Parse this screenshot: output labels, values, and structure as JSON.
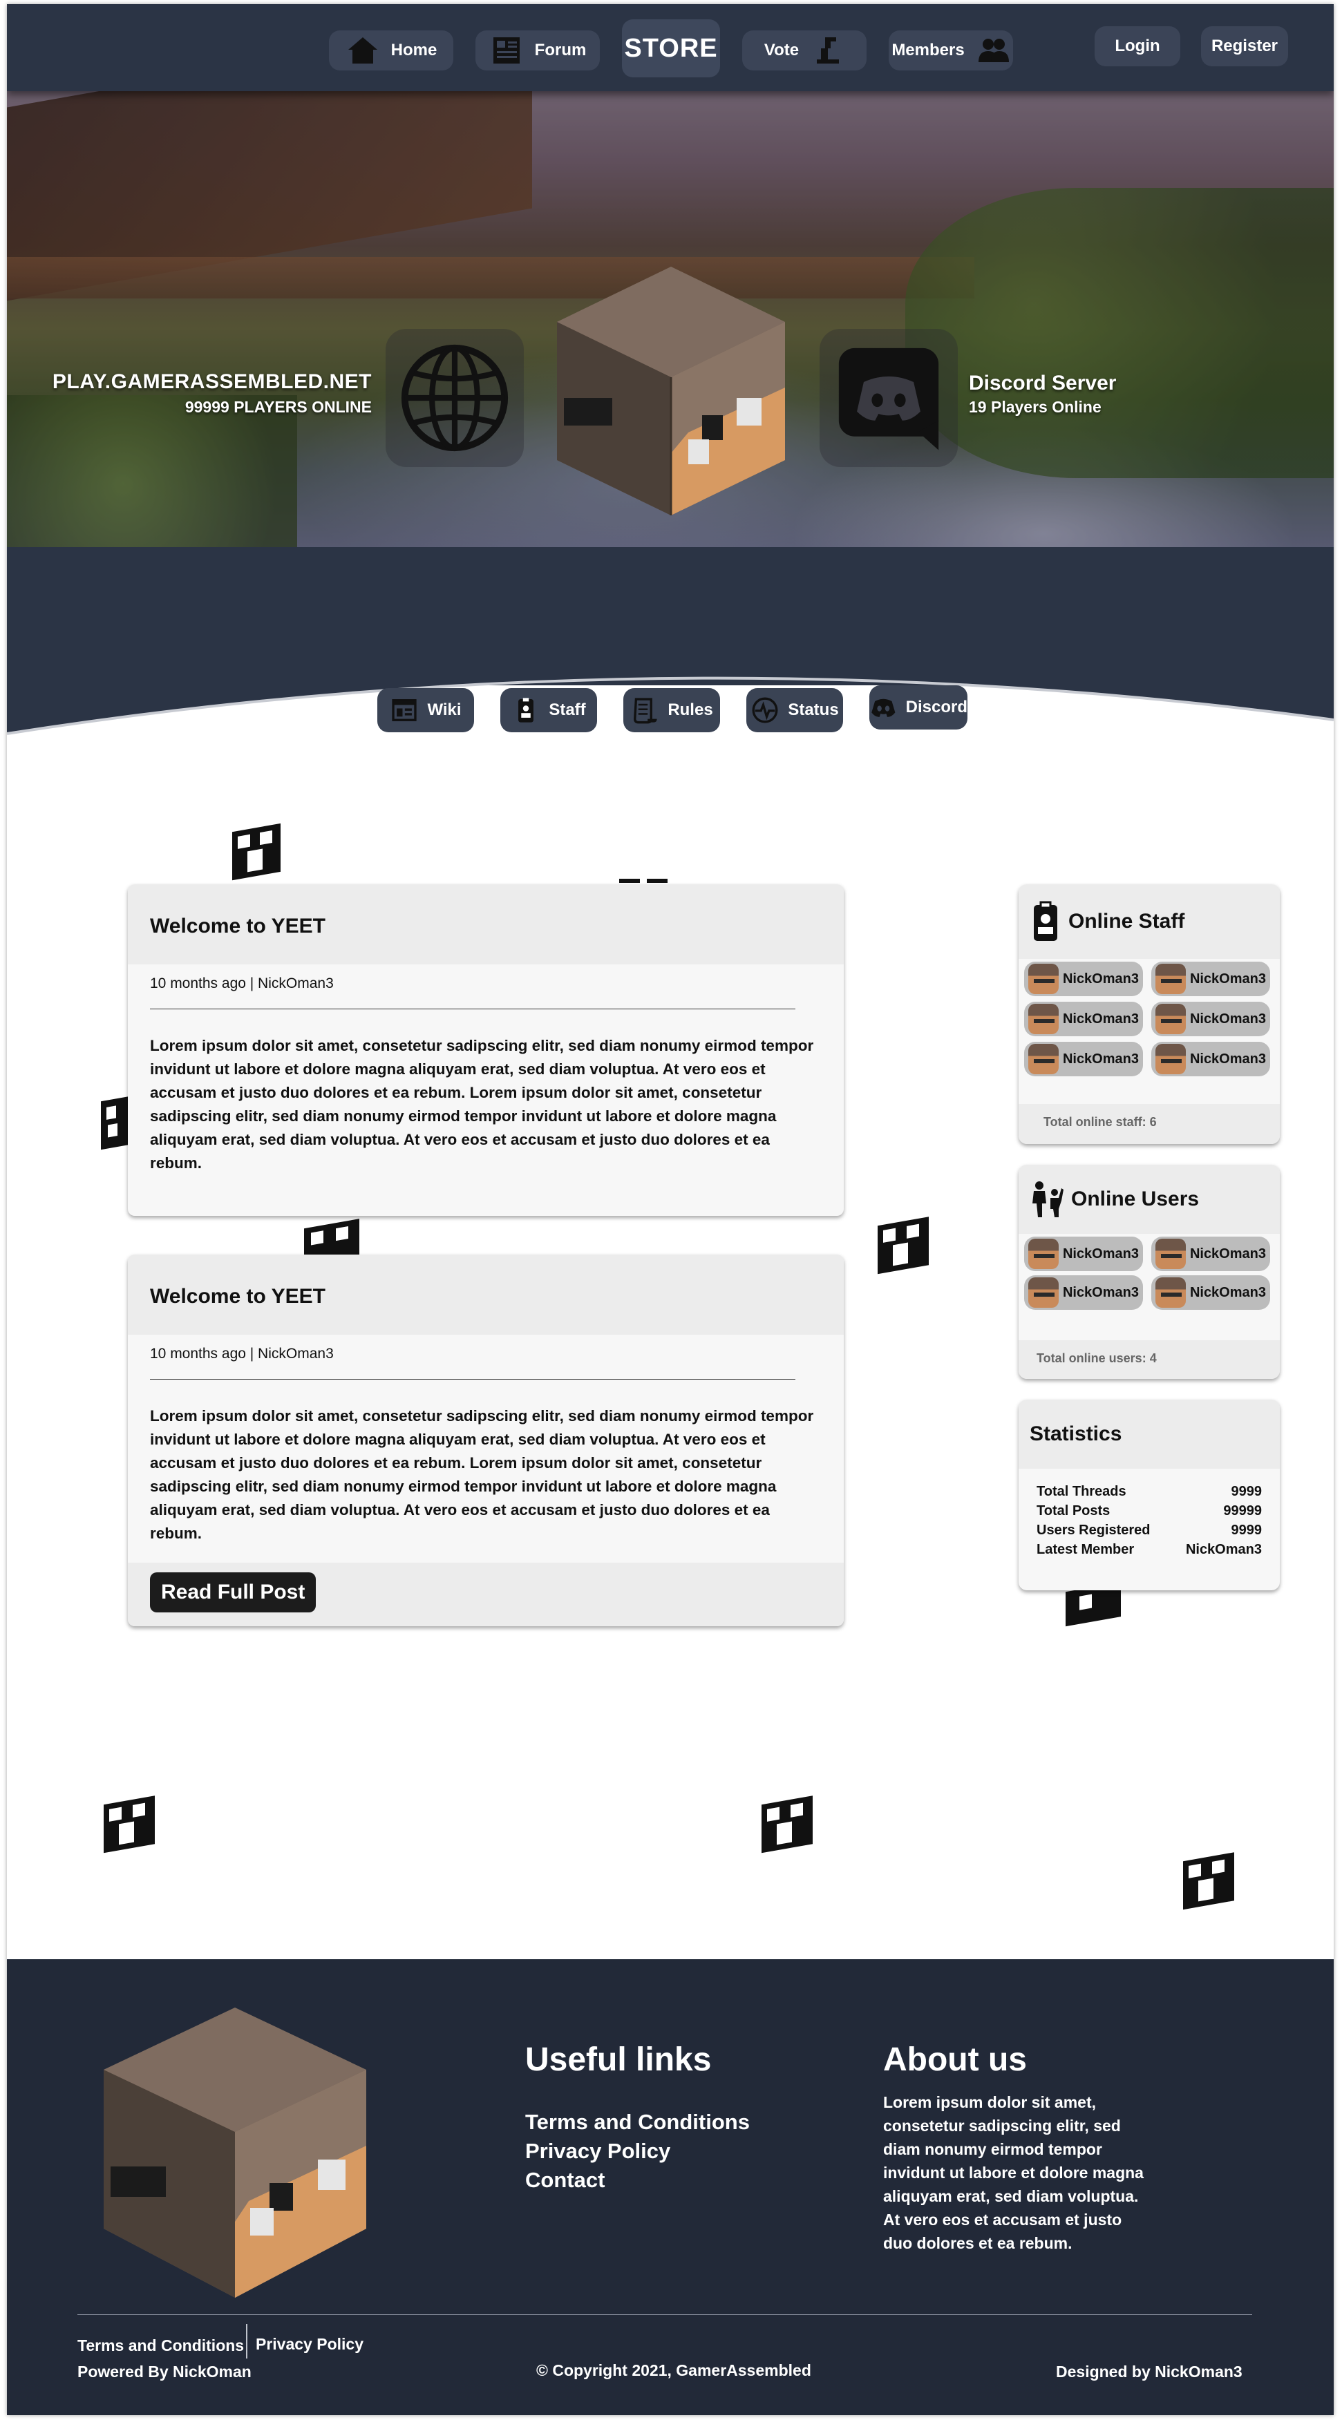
{
  "nav": {
    "home": "Home",
    "forum": "Forum",
    "store": "STORE",
    "vote": "Vote",
    "members": "Members",
    "login": "Login",
    "register": "Register"
  },
  "hero": {
    "server_ip": "PLAY.GAMERASSEMBLED.NET",
    "players_online": "99999 PLAYERS ONLINE",
    "discord_title": "Discord Server",
    "discord_players": "19 Players Online"
  },
  "subnav": {
    "wiki": "Wiki",
    "staff": "Staff",
    "rules": "Rules",
    "status": "Status",
    "discord": "Discord"
  },
  "posts": [
    {
      "title": "Welcome to YEET",
      "meta": "10 months ago | NickOman3",
      "body": "Lorem ipsum dolor sit amet, consetetur sadipscing elitr, sed diam nonumy eirmod tempor invidunt ut labore et dolore magna aliquyam erat, sed diam voluptua. At vero eos et accusam et justo duo dolores et ea rebum. Lorem ipsum dolor sit amet, consetetur sadipscing elitr, sed diam nonumy eirmod tempor invidunt ut labore et dolore magna aliquyam erat, sed diam voluptua. At vero eos et accusam et justo duo dolores et ea rebum."
    },
    {
      "title": "Welcome to YEET",
      "meta": "10 months ago | NickOman3",
      "body": "Lorem ipsum dolor sit amet, consetetur sadipscing elitr, sed diam nonumy eirmod tempor invidunt ut labore et dolore magna aliquyam erat, sed diam voluptua. At vero eos et accusam et justo duo dolores et ea rebum. Lorem ipsum dolor sit amet, consetetur sadipscing elitr, sed diam nonumy eirmod tempor invidunt ut labore et dolore magna aliquyam erat, sed diam voluptua. At vero eos et accusam et justo duo dolores et ea rebum.",
      "read_more": "Read Full Post"
    }
  ],
  "online_staff": {
    "title": "Online Staff",
    "members": [
      "NickOman3",
      "NickOman3",
      "NickOman3",
      "NickOman3",
      "NickOman3",
      "NickOman3"
    ],
    "footer": "Total online staff: 6"
  },
  "online_users": {
    "title": "Online Users",
    "members": [
      "NickOman3",
      "NickOman3",
      "NickOman3",
      "NickOman3"
    ],
    "footer": "Total online users: 4"
  },
  "statistics": {
    "title": "Statistics",
    "rows": [
      {
        "label": "Total Threads",
        "value": "9999"
      },
      {
        "label": "Total Posts",
        "value": "99999"
      },
      {
        "label": "Users Registered",
        "value": "9999"
      },
      {
        "label": "Latest Member",
        "value": "NickOman3"
      }
    ]
  },
  "footer": {
    "useful_links_title": "Useful links",
    "links": [
      "Terms and Conditions",
      "Privacy Policy",
      "Contact"
    ],
    "about_title": "About us",
    "about_text": "Lorem ipsum dolor sit amet, consetetur sadipscing elitr, sed diam nonumy eirmod tempor invidunt ut labore et dolore magna aliquyam erat, sed diam voluptua. At vero eos et accusam et justo duo dolores et ea rebum.",
    "bottom_terms": "Terms and Conditions",
    "bottom_privacy": "Privacy Policy",
    "powered_by": "Powered By NickOman",
    "copyright": "© Copyright 2021, GamerAssembled",
    "designed_by": "Designed by NickOman3"
  },
  "colors": {
    "nav_bg": "#2b3445",
    "button_bg": "#3b4457",
    "footer_bg": "#222938",
    "read_button": "#1c1c1c"
  }
}
